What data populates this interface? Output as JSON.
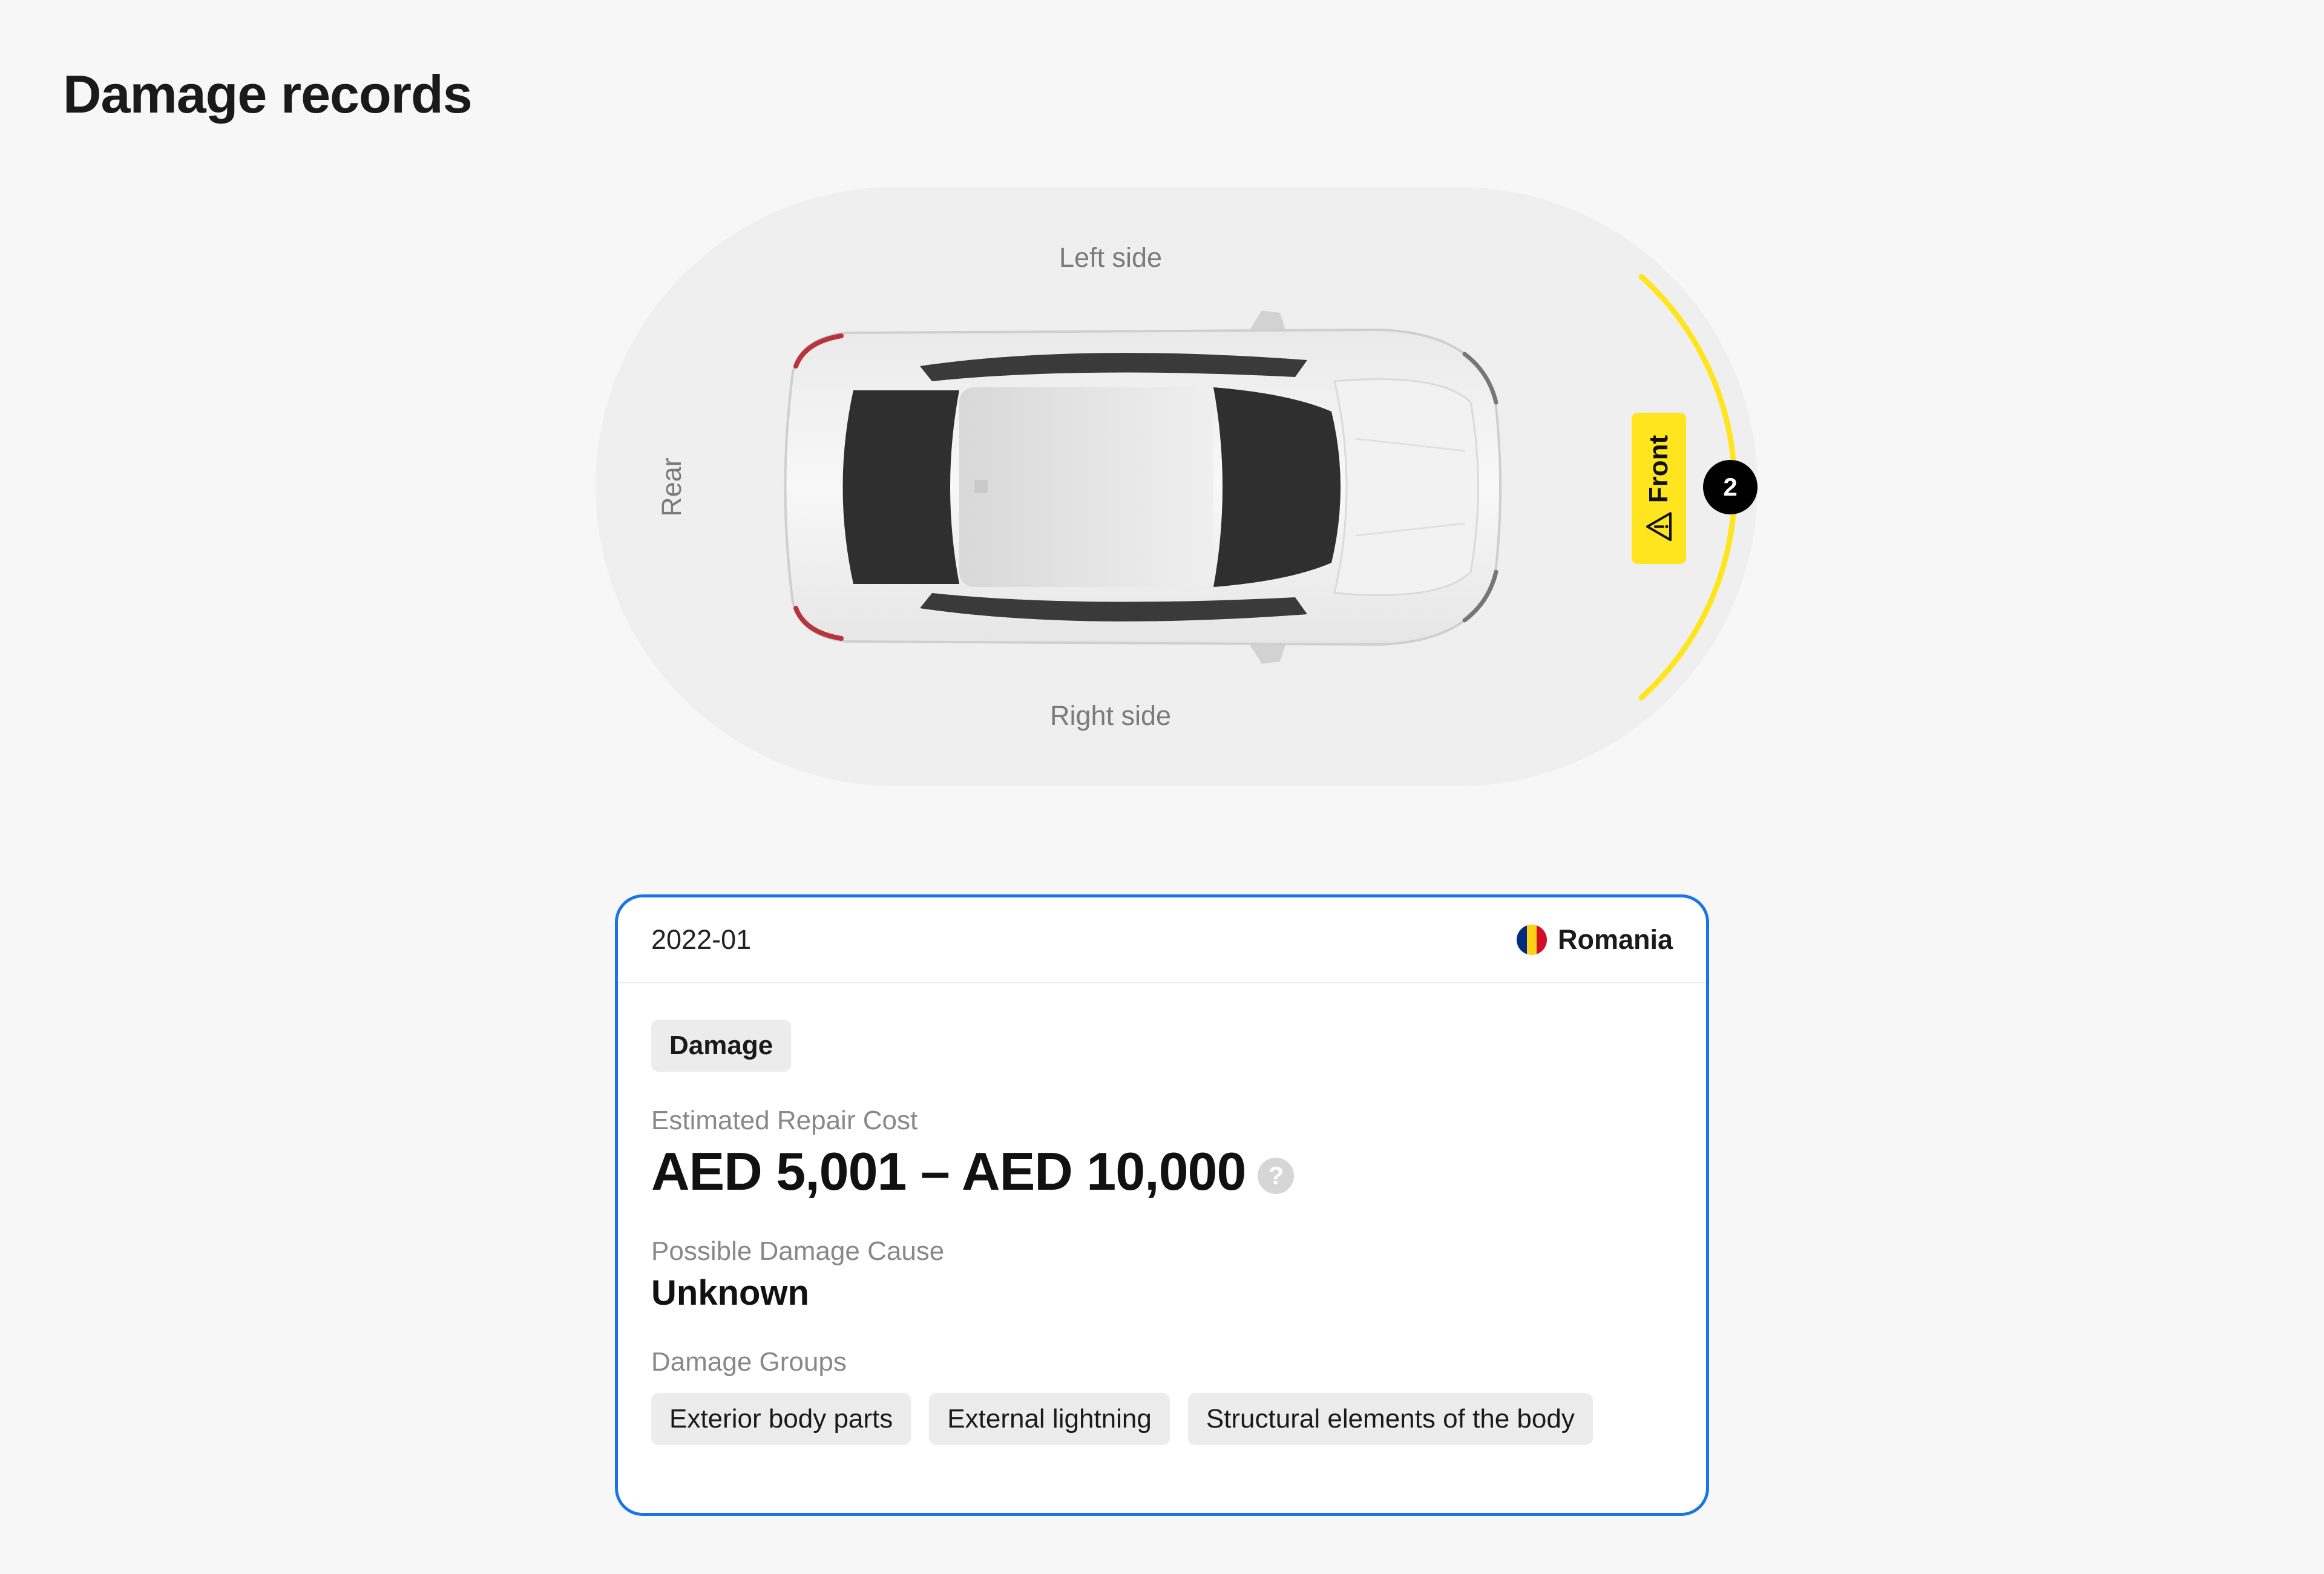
{
  "page": {
    "title": "Damage records"
  },
  "diagram": {
    "labels": {
      "left_side": "Left side",
      "right_side": "Right side",
      "rear": "Rear",
      "front": "Front"
    },
    "highlighted_zone": "Front",
    "damage_count": "2",
    "highlight_color": "#ffe51e"
  },
  "record": {
    "date": "2022-01",
    "country": "Romania",
    "flag_colors": [
      "#002b7f",
      "#fcd116",
      "#ce1126"
    ],
    "type_label": "Damage",
    "cost_label": "Estimated Repair Cost",
    "cost_value": "AED 5,001 – AED 10,000",
    "help_glyph": "?",
    "cause_label": "Possible Damage Cause",
    "cause_value": "Unknown",
    "groups_label": "Damage Groups",
    "groups": [
      "Exterior body parts",
      "External lightning",
      "Structural elements of the body"
    ],
    "border_color": "#1a73e8"
  }
}
